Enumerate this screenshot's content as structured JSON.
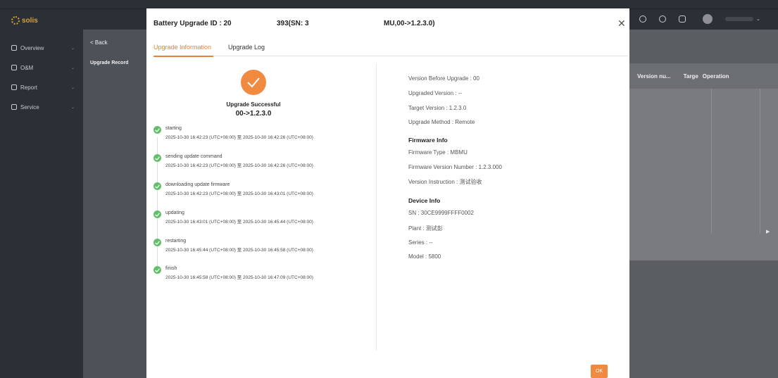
{
  "app": {
    "logo_text": "solis",
    "sidebar": [
      {
        "label": "Overview"
      },
      {
        "label": "O&M"
      },
      {
        "label": "Report"
      },
      {
        "label": "Service"
      }
    ],
    "back_label": "< Back",
    "sub_item": "Upgrade Record",
    "table_headers": [
      "Version nu...",
      "Targe",
      "Operation"
    ]
  },
  "modal": {
    "title_part1": "Battery Upgrade ID : 20",
    "title_part2": "393(SN: 3",
    "title_part3": "MU,00->1.2.3.0)",
    "tabs": [
      {
        "label": "Upgrade Information",
        "active": true
      },
      {
        "label": "Upgrade Log",
        "active": false
      }
    ],
    "status": {
      "title": "Upgrade Successful",
      "version_change": "00->1.2.3.0"
    },
    "steps": [
      {
        "name": "starting",
        "time": "2025-10-30 16:42:23 (UTC+08:00) 至 2025-10-30 16:42:26 (UTC+08:00)"
      },
      {
        "name": "sending update command",
        "time": "2025-10-30 16:42:23 (UTC+08:00) 至 2025-10-30 16:42:26 (UTC+08:00)"
      },
      {
        "name": "downloading update firmware",
        "time": "2025-10-30 16:42:23 (UTC+08:00) 至 2025-10-30 16:43:01 (UTC+08:00)"
      },
      {
        "name": "updating",
        "time": "2025-10-30 16:43:01 (UTC+08:00) 至 2025-10-30 16:45:44 (UTC+08:00)"
      },
      {
        "name": "restarting",
        "time": "2025-10-30 16:45:44 (UTC+08:00) 至 2025-10-30 16:45:58 (UTC+08:00)"
      },
      {
        "name": "finish",
        "time": "2025-10-30 16:45:58 (UTC+08:00) 至 2025-10-30 16:47:09 (UTC+08:00)"
      }
    ],
    "info": {
      "version_before": "Version Before Upgrade : 00",
      "upgraded_version": "Upgraded Version : --",
      "target_version": "Target Version : 1.2.3.0",
      "upgrade_method": "Upgrade Method : Remote",
      "firmware_heading": "Firmware Info",
      "firmware_type": "Firmware Type : MBMU",
      "firmware_version": "Firmware Version Number : 1.2.3.000",
      "version_instruction": "Version Instruction : 测试验收",
      "device_heading": "Device Info",
      "sn": "SN : 30CE9999FFFF0002",
      "plant": "Plant : 测试彭",
      "series": "Series : --",
      "model": "Model : 5800"
    },
    "ok_label": "OK"
  },
  "colors": {
    "accent": "#f08a41",
    "success": "#63c06a",
    "overlay": "#5a5d62"
  }
}
